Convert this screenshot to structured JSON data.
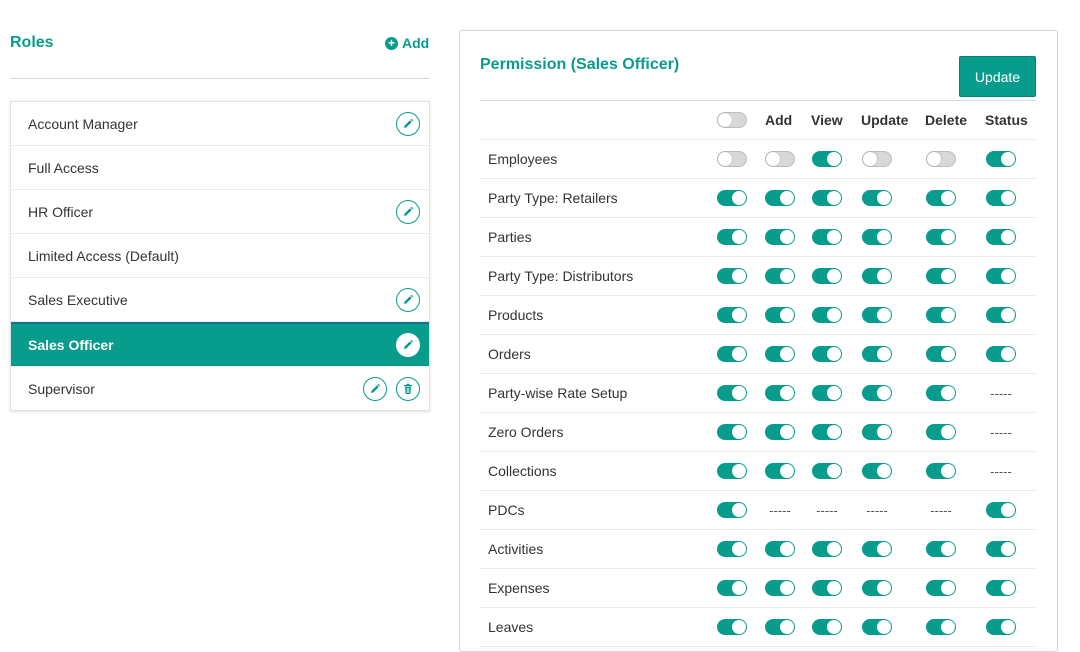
{
  "roles": {
    "title": "Roles",
    "add_label": "Add",
    "items": [
      {
        "label": "Account Manager",
        "edit": true,
        "delete": false,
        "active": false
      },
      {
        "label": "Full Access",
        "edit": false,
        "delete": false,
        "active": false
      },
      {
        "label": "HR Officer",
        "edit": true,
        "delete": false,
        "active": false
      },
      {
        "label": "Limited Access (Default)",
        "edit": false,
        "delete": false,
        "active": false
      },
      {
        "label": "Sales Executive",
        "edit": true,
        "delete": false,
        "active": false
      },
      {
        "label": "Sales Officer",
        "edit": true,
        "delete": false,
        "active": true
      },
      {
        "label": "Supervisor",
        "edit": true,
        "delete": true,
        "active": false
      }
    ]
  },
  "permission": {
    "title": "Permission (Sales Officer)",
    "update_label": "Update",
    "header_toggle": "off",
    "columns": [
      "Add",
      "View",
      "Update",
      "Delete",
      "Status"
    ],
    "placeholder": "-----",
    "rows": [
      {
        "label": "Employees",
        "values": [
          "off",
          "off",
          "on",
          "off",
          "off",
          "on"
        ]
      },
      {
        "label": "Party Type: Retailers",
        "values": [
          "on",
          "on",
          "on",
          "on",
          "on",
          "on"
        ]
      },
      {
        "label": "Parties",
        "values": [
          "on",
          "on",
          "on",
          "on",
          "on",
          "on"
        ]
      },
      {
        "label": "Party Type: Distributors",
        "values": [
          "on",
          "on",
          "on",
          "on",
          "on",
          "on"
        ]
      },
      {
        "label": "Products",
        "values": [
          "on",
          "on",
          "on",
          "on",
          "on",
          "on"
        ]
      },
      {
        "label": "Orders",
        "values": [
          "on",
          "on",
          "on",
          "on",
          "on",
          "on"
        ]
      },
      {
        "label": "Party-wise Rate Setup",
        "values": [
          "on",
          "on",
          "on",
          "on",
          "on",
          "-----"
        ]
      },
      {
        "label": "Zero Orders",
        "values": [
          "on",
          "on",
          "on",
          "on",
          "on",
          "-----"
        ]
      },
      {
        "label": "Collections",
        "values": [
          "on",
          "on",
          "on",
          "on",
          "on",
          "-----"
        ]
      },
      {
        "label": "PDCs",
        "values": [
          "on",
          "-----",
          "-----",
          "-----",
          "-----",
          "on"
        ]
      },
      {
        "label": "Activities",
        "values": [
          "on",
          "on",
          "on",
          "on",
          "on",
          "on"
        ]
      },
      {
        "label": "Expenses",
        "values": [
          "on",
          "on",
          "on",
          "on",
          "on",
          "on"
        ]
      },
      {
        "label": "Leaves",
        "values": [
          "on",
          "on",
          "on",
          "on",
          "on",
          "on"
        ]
      }
    ]
  },
  "colors": {
    "accent": "#089c8c",
    "active_border": "#1a6e8e",
    "toggle_off": "#d8d8d8"
  },
  "icons": {
    "edit": "pencil-icon",
    "delete": "trash-icon",
    "add": "plus-circle-icon"
  }
}
